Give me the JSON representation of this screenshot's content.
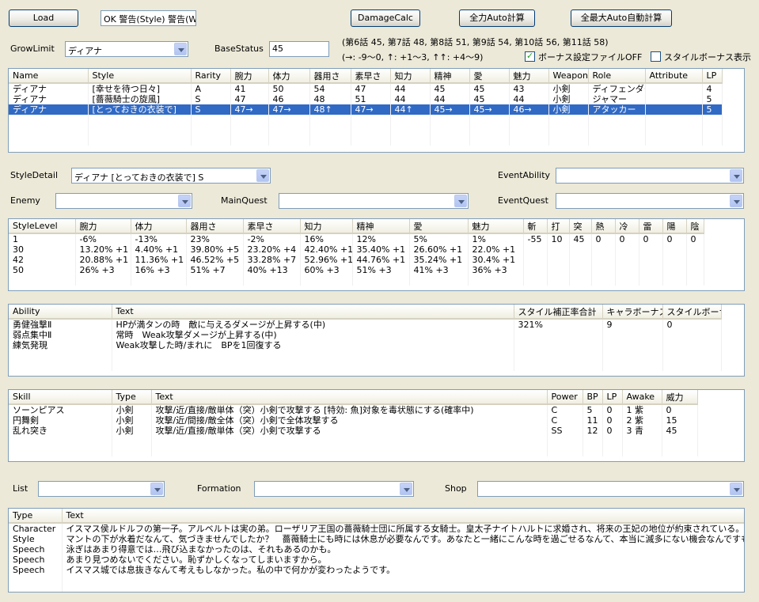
{
  "toolbar": {
    "load_label": "Load",
    "message": "OK 警告(Style) 警告(W",
    "damagecalc_label": "DamageCalc",
    "auto_calc_label": "全力Auto計算",
    "max_auto_calc_label": "全最大Auto自動計算"
  },
  "grow_limit": {
    "label": "GrowLimit",
    "value": "ディアナ"
  },
  "base_status": {
    "label": "BaseStatus",
    "value": "45"
  },
  "info": {
    "line1": "(第6話 45, 第7話 48, 第8話 51, 第9話 54, 第10話 56, 第11話 58)",
    "line2": "(→: -9～0, ↑: +1～3, ↑↑: +4～9)",
    "bonus_file_label": "ボーナス設定ファイルOFF",
    "bonus_file_checked": true,
    "style_bonus_label": "スタイルボーナス表示",
    "style_bonus_checked": false
  },
  "style_grid": {
    "columns": [
      "Name",
      "Style",
      "Rarity",
      "腕力",
      "体力",
      "器用さ",
      "素早さ",
      "知力",
      "精神",
      "愛",
      "魅力",
      "Weapon",
      "Role",
      "Attribute",
      "LP"
    ],
    "rows": [
      [
        "ディアナ",
        "[幸せを待つ日々]",
        "A",
        "41",
        "50",
        "54",
        "47",
        "44",
        "45",
        "45",
        "43",
        "小剣",
        "ディフェンダー",
        "",
        "4"
      ],
      [
        "ディアナ",
        "[薔薇騎士の旋風]",
        "S",
        "47",
        "46",
        "48",
        "51",
        "44",
        "44",
        "45",
        "44",
        "小剣",
        "ジャマー",
        "",
        "5"
      ],
      [
        "ディアナ",
        "[とっておきの衣装で]",
        "S",
        "47→",
        "47→",
        "48↑",
        "47→",
        "44↑",
        "45→",
        "45→",
        "46→",
        "小剣",
        "アタッカー",
        "",
        "5"
      ]
    ],
    "selected_row": 2
  },
  "style_detail": {
    "label": "StyleDetail",
    "value": "ディアナ [とっておきの衣装で] S"
  },
  "event_ability": {
    "label": "EventAbility",
    "value": ""
  },
  "enemy": {
    "label": "Enemy",
    "value": ""
  },
  "main_quest": {
    "label": "MainQuest",
    "value": ""
  },
  "event_quest": {
    "label": "EventQuest",
    "value": ""
  },
  "level_grid": {
    "columns": [
      "StyleLevel",
      "腕力",
      "体力",
      "器用さ",
      "素早さ",
      "知力",
      "精神",
      "愛",
      "魅力",
      "斬",
      "打",
      "突",
      "熱",
      "冷",
      "雷",
      "陽",
      "陰"
    ],
    "rows": [
      [
        "1",
        "-6%",
        "-13%",
        "23%",
        "-2%",
        "16%",
        "12%",
        "5%",
        "1%",
        "-55",
        "10",
        "45",
        "0",
        "0",
        "0",
        "0",
        "0"
      ],
      [
        "30",
        "13.20% +1",
        "4.40% +1",
        "39.80% +5",
        "23.20% +4",
        "42.40% +1",
        "35.40% +1",
        "26.60% +1",
        "22.0% +1",
        "",
        "",
        "",
        "",
        "",
        "",
        "",
        ""
      ],
      [
        "42",
        "20.88% +1",
        "11.36% +1",
        "46.52% +5",
        "33.28% +7",
        "52.96% +1",
        "44.76% +1",
        "35.24% +1",
        "30.4% +1",
        "",
        "",
        "",
        "",
        "",
        "",
        "",
        ""
      ],
      [
        "50",
        "26% +3",
        "16% +3",
        "51% +7",
        "40% +13",
        "60% +3",
        "51% +3",
        "41% +3",
        "36% +3",
        "",
        "",
        "",
        "",
        "",
        "",
        "",
        ""
      ]
    ]
  },
  "ability_grid": {
    "columns": [
      "Ability",
      "Text",
      "スタイル補正率合計",
      "キャラボーナス",
      "スタイルボーナス"
    ],
    "rows": [
      [
        "勇健強撃Ⅱ",
        "HPが満タンの時　敵に与えるダメージが上昇する(中)",
        "321%",
        "9",
        "0"
      ],
      [
        "弱点集中Ⅱ",
        "常時　Weak攻撃ダメージが上昇する(中)",
        "",
        "",
        ""
      ],
      [
        "練気発現",
        "Weak攻撃した時/まれに　BPを1回復する",
        "",
        "",
        ""
      ]
    ]
  },
  "skill_grid": {
    "columns": [
      "Skill",
      "Type",
      "Text",
      "Power",
      "BP",
      "LP",
      "Awake",
      "威力"
    ],
    "rows": [
      [
        "ソーンピアス",
        "小剣",
        "攻撃/近/直接/敵単体（突）小剣で攻撃する [特効: 魚]対象を毒状態にする(確率中)",
        "C",
        "5",
        "0",
        "1 紫",
        "0"
      ],
      [
        "円舞剣",
        "小剣",
        "攻撃/近/間接/敵全体（突）小剣で全体攻撃する",
        "C",
        "11",
        "0",
        "2 紫",
        "15"
      ],
      [
        "乱れ突き",
        "小剣",
        "攻撃/近/直接/敵単体（突）小剣で攻撃する",
        "SS",
        "12",
        "0",
        "3 青",
        "45"
      ]
    ]
  },
  "list": {
    "label": "List",
    "value": ""
  },
  "formation": {
    "label": "Formation",
    "value": ""
  },
  "shop": {
    "label": "Shop",
    "value": ""
  },
  "text_grid": {
    "columns": [
      "Type",
      "Text"
    ],
    "rows": [
      [
        "Character",
        "イスマス侯ルドルフの第一子。アルベルトは実の弟。ローザリア王国の薔薇騎士団に所属する女騎士。皇太子ナイトハルトに求婚され、将来の王妃の地位が約束されている。アル..."
      ],
      [
        "Style",
        "マントの下が水着だなんて、気づきませんでしたか？　薔薇騎士にも時には休息が必要なんです。あなたと一緒にこんな時を過ごせるなんて、本当に滅多にない機会なんですもの。"
      ],
      [
        "Speech",
        "泳ぎはあまり得意では…飛び込まなかったのは、それもあるのかも。"
      ],
      [
        "Speech",
        "あまり見つめないでください。恥ずかしくなってしまいますから。"
      ],
      [
        "Speech",
        "イスマス城では息抜きなんて考えもしなかった。私の中で何かが変わったようです。"
      ]
    ]
  }
}
